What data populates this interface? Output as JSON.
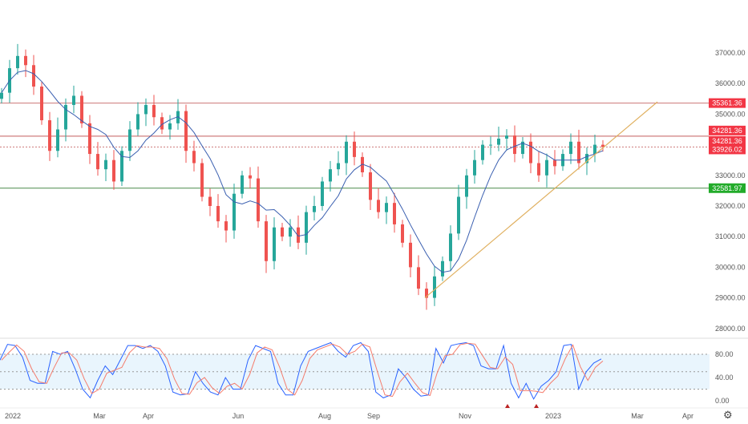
{
  "chart_data": {
    "type": "candlestick",
    "title": "",
    "y_ticks": [
      "37000.00",
      "36000.00",
      "35000.00",
      "33000.00",
      "32000.00",
      "31000.00",
      "30000.00",
      "29000.00",
      "28000.00"
    ],
    "y_tick_values": [
      37000,
      36000,
      35000,
      33000,
      32000,
      31000,
      30000,
      29000,
      28000
    ],
    "ylim": [
      28000,
      37000
    ],
    "x_labels": [
      "2022",
      "Mar",
      "Apr",
      "Jun",
      "Aug",
      "Sep",
      "Nov",
      "2023",
      "Mar",
      "Apr"
    ],
    "closes": [
      35700,
      36500,
      36900,
      36600,
      35900,
      34800,
      33800,
      34500,
      35300,
      35600,
      34700,
      33700,
      33200,
      33500,
      32800,
      33800,
      34500,
      35000,
      35300,
      34900,
      34500,
      34700,
      35100,
      33800,
      33400,
      32300,
      32000,
      31500,
      31200,
      32400,
      33000,
      32900,
      31500,
      30200,
      31300,
      31000,
      31300,
      30800,
      31800,
      32000,
      32800,
      33200,
      33400,
      34100,
      33600,
      33100,
      32200,
      31800,
      32100,
      31400,
      30800,
      30000,
      29300,
      29000,
      29700,
      30200,
      31100,
      32300,
      33000,
      33500,
      34000,
      34000,
      34200,
      34300,
      33700,
      34100,
      33400,
      33000,
      33500,
      33300,
      33700,
      34100,
      33400,
      33700,
      34000,
      33926
    ],
    "levels": [
      {
        "label": "35361.36",
        "value": 35361.36,
        "color": "#f23645"
      },
      {
        "label": "34281.36",
        "value": 34281.36,
        "color": "#f23645"
      },
      {
        "label": "34281.36",
        "value": 34281.36,
        "color": "#f23645"
      },
      {
        "label": "33926.02",
        "value": 33926.02,
        "color": "#f23645"
      },
      {
        "label": "32581.97",
        "value": 32581.97,
        "color": "#22ab2a"
      }
    ],
    "trendline": {
      "from": 29000,
      "to": 35400
    },
    "oscillator": {
      "ticks": [
        "80.00",
        "40.00",
        "0.00"
      ],
      "tick_values": [
        80,
        40,
        0
      ],
      "bands": [
        80,
        50,
        20
      ],
      "k": [
        70,
        97,
        95,
        75,
        35,
        30,
        30,
        85,
        80,
        85,
        55,
        20,
        5,
        35,
        60,
        45,
        70,
        95,
        95,
        90,
        95,
        85,
        60,
        15,
        10,
        12,
        50,
        30,
        15,
        10,
        40,
        20,
        20,
        70,
        95,
        90,
        85,
        30,
        10,
        10,
        60,
        85,
        90,
        95,
        100,
        85,
        75,
        95,
        100,
        85,
        15,
        5,
        10,
        55,
        40,
        20,
        8,
        10,
        90,
        65,
        95,
        98,
        100,
        95,
        60,
        55,
        55,
        95,
        30,
        5,
        30,
        3,
        25,
        35,
        50,
        95,
        97,
        20,
        50,
        65,
        72
      ]
    },
    "colors": {
      "up": "#26a69a",
      "down": "#ef5350",
      "ma": "#3a5fb0",
      "trend": "#e0b060"
    }
  }
}
